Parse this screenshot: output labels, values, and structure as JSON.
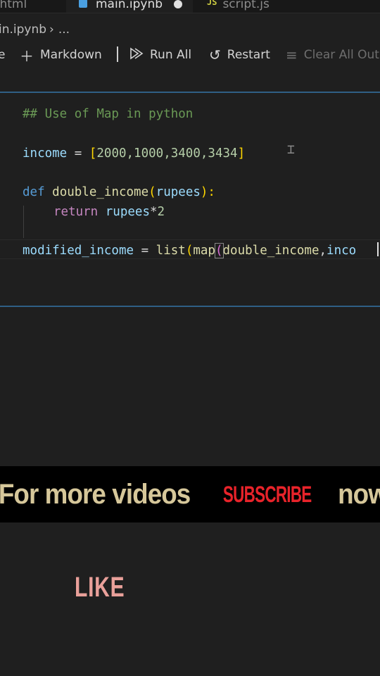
{
  "tabs": [
    {
      "label": "x.html"
    },
    {
      "label": "main.ipynb",
      "modified": true
    },
    {
      "label": "script.js",
      "icon": "JS"
    }
  ],
  "breadcrumb": {
    "file": "in.ipynb",
    "ellipsis": "..."
  },
  "toolbar": {
    "partial_label": "e",
    "markdown_label": "Markdown",
    "run_all_label": "Run All",
    "restart_label": "Restart",
    "clear_all_label": "Clear All Out"
  },
  "code": {
    "line1": "## Use of Map in python",
    "line2": {
      "var": "income",
      "op": " = ",
      "open": "[",
      "nums": "2000,1000,3400,3434",
      "close": "]"
    },
    "line3": {
      "kw": "def",
      "fn": "double_income",
      "open": "(",
      "param": "rupees",
      "close": "):"
    },
    "line4": {
      "kw": "return",
      "expr": "rupees",
      "op": "*",
      "num": "2"
    },
    "line5": {
      "var": "modified_income",
      "op": " = ",
      "fn1": "list",
      "p1": "(",
      "fn2": "map",
      "p2": "(",
      "arg1": "double_income",
      "comma": ",",
      "arg2": "inco"
    }
  },
  "banner": {
    "text_before": "For more videos",
    "subscribe": "SUBSCRIBE",
    "text_after": "now"
  },
  "like": "LIKE",
  "colors": {
    "accent_border": "#2f5f85",
    "banner_text": "#d6c79a",
    "subscribe": "#e8232a",
    "like": "#e9a09a"
  }
}
